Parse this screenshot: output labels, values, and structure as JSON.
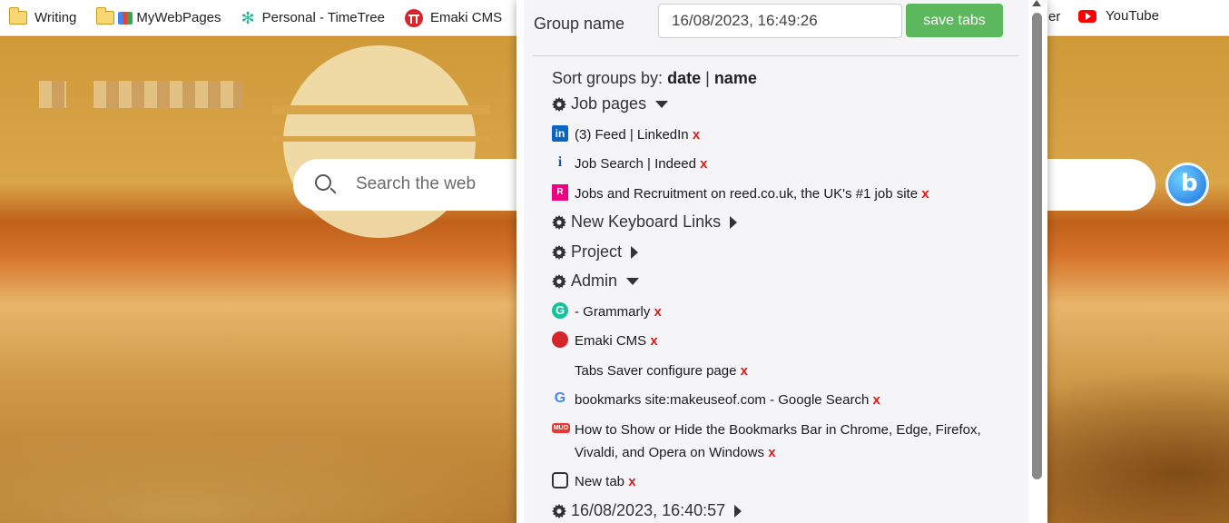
{
  "bookmarks": {
    "items": [
      {
        "label": "Writing",
        "icon": "folder-icon"
      },
      {
        "label": "MyWebPages",
        "icon": "folder-icon"
      },
      {
        "label": "Personal - TimeTree",
        "icon": "timetree-icon"
      },
      {
        "label": "Emaki CMS",
        "icon": "emaki-icon"
      }
    ],
    "right_fragment": "er",
    "youtube": {
      "label": "YouTube",
      "icon": "youtube-icon"
    }
  },
  "search": {
    "placeholder": "Search the web"
  },
  "popup": {
    "group_name_label": "Group name",
    "group_name_value": "16/08/2023, 16:49:26",
    "save_label": "save tabs",
    "sort_prefix": "Sort groups by:",
    "sort_date": "date",
    "sort_separator": "|",
    "sort_name": "name",
    "remove_label": "x",
    "groups": [
      {
        "name": "Job pages",
        "expanded": true,
        "tabs": [
          {
            "title": "(3) Feed | LinkedIn",
            "favicon": "linkedin-icon"
          },
          {
            "title": "Job Search | Indeed",
            "favicon": "indeed-icon"
          },
          {
            "title": "Jobs and Recruitment on reed.co.uk, the UK's #1 job site",
            "favicon": "reed-icon"
          }
        ]
      },
      {
        "name": "New Keyboard Links",
        "expanded": false,
        "tabs": []
      },
      {
        "name": "Project",
        "expanded": false,
        "tabs": []
      },
      {
        "name": "Admin",
        "expanded": true,
        "tabs": [
          {
            "title": "- Grammarly",
            "favicon": "grammarly-icon"
          },
          {
            "title": "Emaki CMS",
            "favicon": "emaki-icon"
          },
          {
            "title": "Tabs Saver configure page",
            "favicon": ""
          },
          {
            "title": "bookmarks site:makeuseof.com - Google Search",
            "favicon": "google-icon"
          },
          {
            "title": "How to Show or Hide the Bookmarks Bar in Chrome, Edge, Firefox, Vivaldi, and Opera on Windows",
            "favicon": "makeuseof-icon"
          },
          {
            "title": "New tab",
            "favicon": "new-tab-icon"
          }
        ]
      },
      {
        "name": "16/08/2023, 16:40:57",
        "expanded": false,
        "tabs": []
      }
    ]
  }
}
